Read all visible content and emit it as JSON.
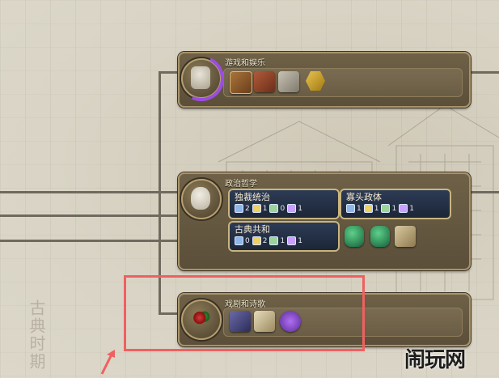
{
  "era": {
    "label": "古典时期"
  },
  "cards": {
    "games": {
      "title": "游戏和娱乐"
    },
    "politics": {
      "title": "政治哲学"
    },
    "drama": {
      "title": "戏剧和诗歌"
    }
  },
  "governments": [
    {
      "name": "独裁统治",
      "slots": [
        "2",
        "1",
        "0",
        "1"
      ]
    },
    {
      "name": "寡头政体",
      "slots": [
        "1",
        "1",
        "1",
        "1"
      ]
    },
    {
      "name": "古典共和",
      "slots": [
        "0",
        "2",
        "1",
        "1"
      ]
    }
  ],
  "watermark": "闹玩网",
  "colors": {
    "highlight": "#f06060",
    "progress_ring": "#9b4de0"
  }
}
